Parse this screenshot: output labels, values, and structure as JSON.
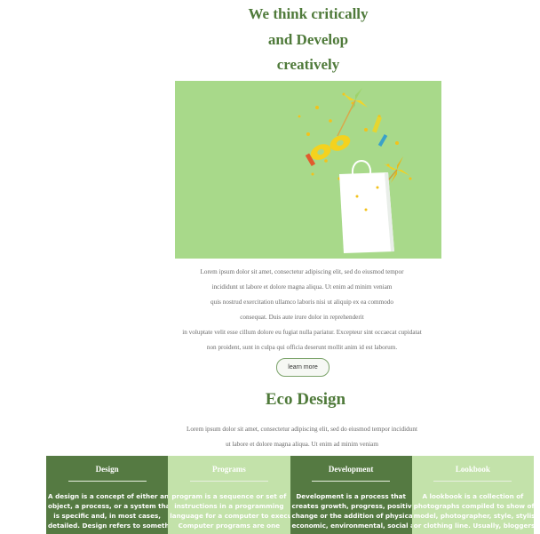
{
  "hero": {
    "title_lines": [
      "We think critically",
      "and Develop",
      "creatively"
    ],
    "image_subject": "white-gift-bag-with-party-items-on-green"
  },
  "intro": {
    "lines": [
      "Lorem ipsum dolor sit amet, consectetur adipiscing elit, sed do eiusmod tempor",
      "incididunt ut labore et dolore magna aliqua. Ut enim ad minim veniam",
      "quis nostrud exercitation ullamco laboris nisi ut aliquip ex ea commodo",
      "consequat. Duis aute irure dolor in reprehenderit",
      "in voluptate velit esse cillum dolore eu fugiat nulla pariatur. Excepteur sint occaecat cupidatat",
      "non proident, sunt in culpa qui officia deserunt mollit anim id est laborum."
    ],
    "button_label": "learn more"
  },
  "eco": {
    "title": "Eco Design",
    "lines": [
      "Lorem ipsum dolor sit amet, consectetur adipiscing elit, sed do eiusmod tempor incididunt",
      "ut labore et dolore magna aliqua. Ut enim ad minim veniam"
    ]
  },
  "cards": [
    {
      "title": "Design",
      "text_lines": [
        "A design is a concept of either an",
        "object, a process, or a system that",
        "is specific and, in most cases,",
        "detailed. Design refers to something"
      ]
    },
    {
      "title": "Programs",
      "text_lines": [
        "program is a sequence or set of",
        "instructions in a programming",
        "language for a computer to execute.",
        "Computer programs are one"
      ]
    },
    {
      "title": "Development",
      "text_lines": [
        "Development is a process that",
        "creates growth, progress, positive",
        "change or the addition of physical,",
        "economic, environmental, social and"
      ]
    },
    {
      "title": "Lookbook",
      "text_lines": [
        "A lookbook is a collection of",
        "photographs compiled to show off a",
        "model, photographer, style, stylist,",
        "or clothing line. Usually, bloggers or"
      ]
    }
  ],
  "colors": {
    "accent_green": "#4f7a3a",
    "card_dark": "#557a42",
    "card_light": "#c3e2aa",
    "image_bg": "#a8d98a"
  }
}
